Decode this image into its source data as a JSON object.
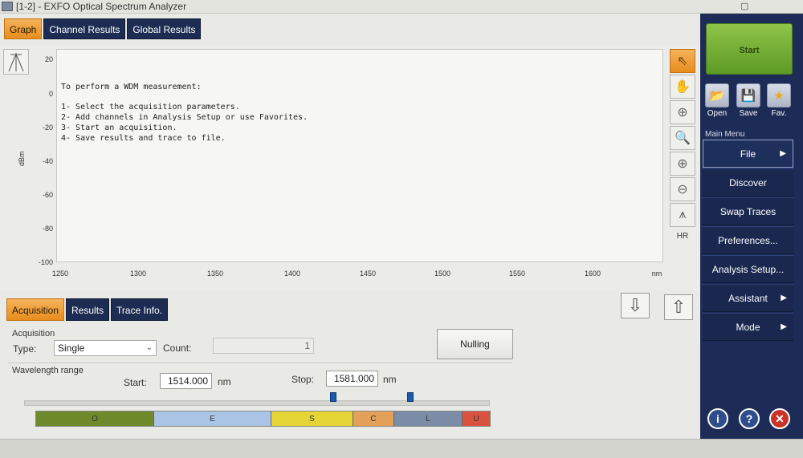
{
  "window": {
    "title": "[1-2] - EXFO Optical Spectrum Analyzer"
  },
  "top_tabs": [
    {
      "label": "Graph",
      "active": true
    },
    {
      "label": "Channel Results",
      "active": false
    },
    {
      "label": "Global Results",
      "active": false
    }
  ],
  "graph": {
    "y_axis_label": "dBm",
    "y_ticks": [
      "20",
      "0",
      "-20",
      "-40",
      "-60",
      "-80",
      "-100"
    ],
    "x_ticks": [
      "1250",
      "1300",
      "1350",
      "1400",
      "1450",
      "1500",
      "1550",
      "1600",
      "nm"
    ],
    "instructions": [
      "To perform a WDM measurement:",
      "1- Select the acquisition parameters.",
      "2- Add channels in Analysis Setup or use Favorites.",
      "3- Start an acquisition.",
      "4- Save results and trace to file."
    ],
    "side_tools": [
      {
        "name": "pointer-icon",
        "glyph": "⇖",
        "active": true
      },
      {
        "name": "pan-hand-icon",
        "glyph": "✋",
        "active": false
      },
      {
        "name": "zoom-area-icon",
        "glyph": "⊕",
        "active": false
      },
      {
        "name": "zoom-icon",
        "glyph": "🔍",
        "active": false
      },
      {
        "name": "zoom-in-icon",
        "glyph": "⊕",
        "active": false
      },
      {
        "name": "zoom-out-icon",
        "glyph": "⊖",
        "active": false
      },
      {
        "name": "full-view-icon",
        "glyph": "⩚",
        "active": false
      }
    ],
    "hr_label": "HR"
  },
  "bottom_tabs": [
    {
      "label": "Acquisition",
      "active": true
    },
    {
      "label": "Results",
      "active": false
    },
    {
      "label": "Trace Info.",
      "active": false
    }
  ],
  "acquisition": {
    "group_label": "Acquisition",
    "type_label": "Type:",
    "type_value": "Single",
    "count_label": "Count:",
    "count_value": "1",
    "nulling_label": "Nulling",
    "wavelength_group": "Wavelength range",
    "start_label": "Start:",
    "start_value": "1514.000",
    "start_unit": "nm",
    "stop_label": "Stop:",
    "stop_value": "1581.000",
    "stop_unit": "nm",
    "bands": [
      {
        "label": "O",
        "color": "#6f8a2a"
      },
      {
        "label": "E",
        "color": "#a9c4e4"
      },
      {
        "label": "S",
        "color": "#e4d436"
      },
      {
        "label": "C",
        "color": "#e2a058"
      },
      {
        "label": "L",
        "color": "#7a8ca6"
      },
      {
        "label": "U",
        "color": "#d9523f"
      }
    ]
  },
  "sidebar": {
    "start_label": "Start",
    "quick": [
      {
        "label": "Open",
        "icon": "open-folder-icon",
        "glyph": "📂"
      },
      {
        "label": "Save",
        "icon": "save-disk-icon",
        "glyph": "💾"
      },
      {
        "label": "Fav.",
        "icon": "star-icon",
        "glyph": "★"
      }
    ],
    "menu_title": "Main Menu",
    "menu": [
      {
        "label": "File",
        "arrow": "▶",
        "selected": true
      },
      {
        "label": "Discover",
        "arrow": ""
      },
      {
        "label": "Swap Traces",
        "arrow": ""
      },
      {
        "label": "Preferences...",
        "arrow": ""
      },
      {
        "label": "Analysis Setup...",
        "arrow": ""
      },
      {
        "label": "Assistant",
        "arrow": "▶"
      },
      {
        "label": "Mode",
        "arrow": "▶"
      }
    ],
    "bottom_buttons": [
      {
        "icon": "info-icon",
        "glyph": "i"
      },
      {
        "icon": "help-icon",
        "glyph": "?"
      },
      {
        "icon": "exit-icon",
        "glyph": "✕"
      }
    ]
  }
}
